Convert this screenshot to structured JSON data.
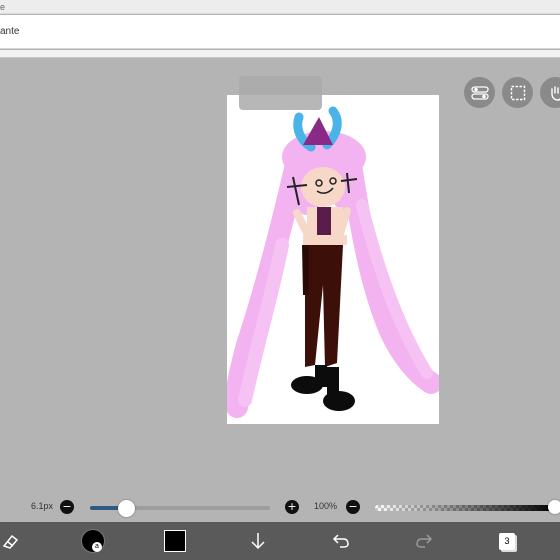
{
  "header": {
    "status_fragment": "e",
    "document_title": "ante"
  },
  "canvas": {
    "tool_badge": "",
    "paper_color": "#ffffff",
    "background_color": "#b4b4b4"
  },
  "right_buttons": [
    {
      "name": "layer-toggle-button",
      "icon": "toggle-icon"
    },
    {
      "name": "selection-button",
      "icon": "selection-icon"
    },
    {
      "name": "hand-tool-button",
      "icon": "hand-icon"
    }
  ],
  "brush": {
    "size_label": "6.1px",
    "size_fraction": 0.2,
    "opacity_label": "100%",
    "opacity_fraction": 1.0,
    "minus": "−",
    "plus": "+"
  },
  "toolbar": {
    "brush_badge": "a",
    "color": "#000000",
    "layer_count": "3",
    "items": [
      "eraser-tool-icon",
      "brush-settings",
      "color-swatch",
      "download-icon",
      "undo-icon",
      "redo-icon",
      "layers-button"
    ]
  }
}
